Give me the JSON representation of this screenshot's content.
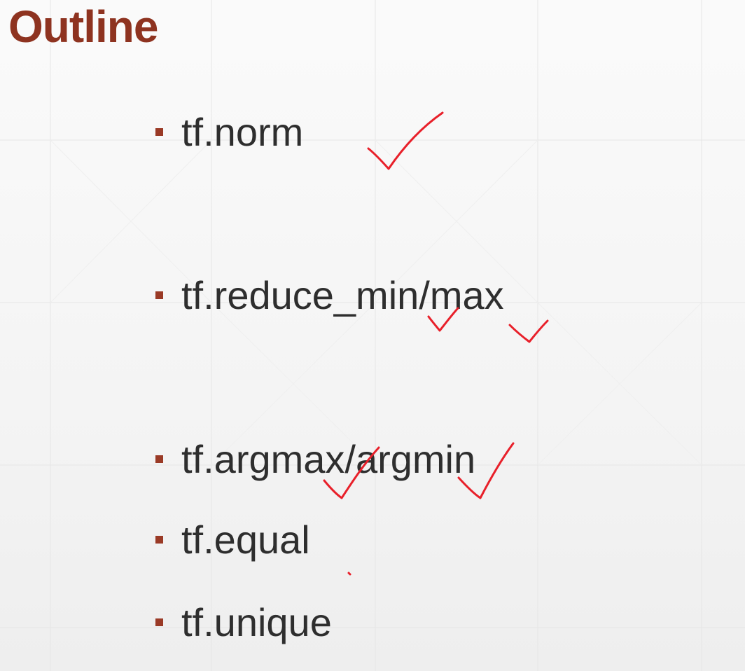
{
  "slide": {
    "title": "Outline",
    "items": [
      {
        "text": "tf.norm",
        "checked": true
      },
      {
        "text": "tf.reduce_min/max",
        "checked": true
      },
      {
        "text": "tf.argmax/argmin",
        "checked": true
      },
      {
        "text": "tf.equal",
        "checked": false
      },
      {
        "text": "tf.unique",
        "checked": false
      }
    ]
  },
  "colors": {
    "title": "#8e3320",
    "bullet": "#9a3a26",
    "text": "#2e2e2e",
    "annotation": "#e8202a"
  },
  "annotations": {
    "icon": "handwritten-checkmark-icon"
  }
}
